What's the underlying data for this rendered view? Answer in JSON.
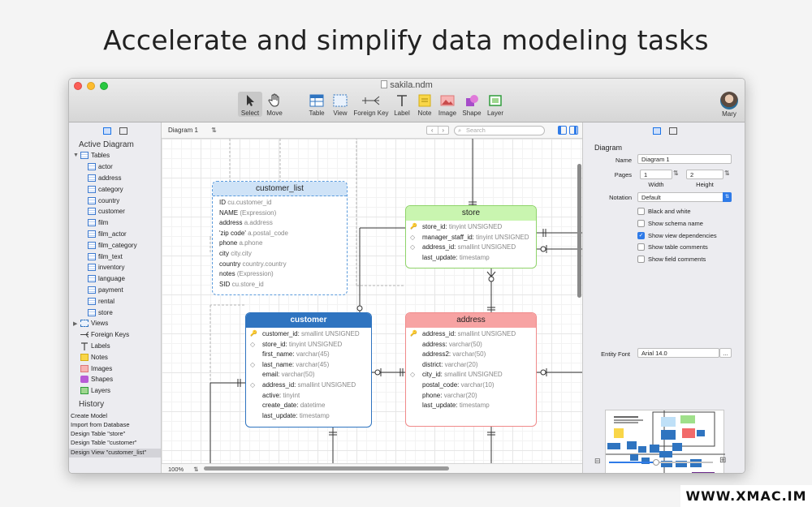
{
  "headline": "Accelerate and simplify data modeling tasks",
  "window": {
    "title": "sakila.ndm"
  },
  "toolbar": {
    "tools": [
      {
        "label": "Select",
        "icon": "cursor-icon"
      },
      {
        "label": "Move",
        "icon": "hand-icon"
      },
      {
        "label": "Table",
        "icon": "table-icon"
      },
      {
        "label": "View",
        "icon": "view-icon"
      },
      {
        "label": "Foreign Key",
        "icon": "foreign-key-icon"
      },
      {
        "label": "Label",
        "icon": "label-icon"
      },
      {
        "label": "Note",
        "icon": "note-icon"
      },
      {
        "label": "Image",
        "icon": "image-icon"
      },
      {
        "label": "Shape",
        "icon": "shape-icon"
      },
      {
        "label": "Layer",
        "icon": "layer-icon"
      }
    ],
    "user": "Mary"
  },
  "sidebar": {
    "section_title": "Active Diagram",
    "tables_label": "Tables",
    "tables": [
      "actor",
      "address",
      "category",
      "country",
      "customer",
      "film",
      "film_actor",
      "film_category",
      "film_text",
      "inventory",
      "language",
      "payment",
      "rental",
      "store"
    ],
    "other": [
      {
        "label": "Views"
      },
      {
        "label": "Foreign Keys"
      },
      {
        "label": "Labels"
      },
      {
        "label": "Notes"
      },
      {
        "label": "Images"
      },
      {
        "label": "Shapes"
      },
      {
        "label": "Layers"
      }
    ],
    "history_title": "History",
    "history": [
      "Create Model",
      "Import from Database",
      "Design Table \"store\"",
      "Design Table \"customer\"",
      "Design View \"customer_list\""
    ]
  },
  "canvas_bar": {
    "diagram_select": "Diagram 1",
    "search_placeholder": "Search",
    "zoom": "100%"
  },
  "entities": {
    "customer_list": {
      "title": "customer_list",
      "rows": [
        {
          "name": "ID",
          "type": "cu.customer_id"
        },
        {
          "name": "NAME",
          "type": "(Expression)"
        },
        {
          "name": "address",
          "type": "a.address"
        },
        {
          "name": "'zip code'",
          "type": "a.postal_code"
        },
        {
          "name": "phone",
          "type": "a.phone"
        },
        {
          "name": "city",
          "type": "city.city"
        },
        {
          "name": "country",
          "type": "country.country"
        },
        {
          "name": "notes",
          "type": "(Expression)"
        },
        {
          "name": "SID",
          "type": "cu.store_id"
        }
      ]
    },
    "store": {
      "title": "store",
      "color": "#c9f5b0",
      "rows": [
        {
          "name": "store_id:",
          "type": "tinyint UNSIGNED",
          "mark": "key"
        },
        {
          "name": "manager_staff_id:",
          "type": "tinyint UNSIGNED",
          "mark": "dia"
        },
        {
          "name": "address_id:",
          "type": "smallint UNSIGNED",
          "mark": "dia"
        },
        {
          "name": "last_update:",
          "type": "timestamp",
          "mark": ""
        }
      ]
    },
    "customer": {
      "title": "customer",
      "color": "#2f74c0",
      "rows": [
        {
          "name": "customer_id:",
          "type": "smallint UNSIGNED",
          "mark": "key"
        },
        {
          "name": "store_id:",
          "type": "tinyint UNSIGNED",
          "mark": "dia"
        },
        {
          "name": "first_name:",
          "type": "varchar(45)",
          "mark": ""
        },
        {
          "name": "last_name:",
          "type": "varchar(45)",
          "mark": "dia"
        },
        {
          "name": "email:",
          "type": "varchar(50)",
          "mark": ""
        },
        {
          "name": "address_id:",
          "type": "smallint UNSIGNED",
          "mark": "dia"
        },
        {
          "name": "active:",
          "type": "tinyint",
          "mark": ""
        },
        {
          "name": "create_date:",
          "type": "datetime",
          "mark": ""
        },
        {
          "name": "last_update:",
          "type": "timestamp",
          "mark": ""
        }
      ]
    },
    "address": {
      "title": "address",
      "color": "#f7a3a3",
      "rows": [
        {
          "name": "address_id:",
          "type": "smallint UNSIGNED",
          "mark": "key"
        },
        {
          "name": "address:",
          "type": "varchar(50)",
          "mark": ""
        },
        {
          "name": "address2:",
          "type": "varchar(50)",
          "mark": ""
        },
        {
          "name": "district:",
          "type": "varchar(20)",
          "mark": ""
        },
        {
          "name": "city_id:",
          "type": "smallint UNSIGNED",
          "mark": "dia"
        },
        {
          "name": "postal_code:",
          "type": "varchar(10)",
          "mark": ""
        },
        {
          "name": "phone:",
          "type": "varchar(20)",
          "mark": ""
        },
        {
          "name": "last_update:",
          "type": "timestamp",
          "mark": ""
        }
      ]
    }
  },
  "inspector": {
    "section": "Diagram",
    "name_label": "Name",
    "name_value": "Diagram 1",
    "pages_label": "Pages",
    "width_value": "1",
    "height_value": "2",
    "width_label": "Width",
    "height_label": "Height",
    "notation_label": "Notation",
    "notation_value": "Default",
    "checks": [
      {
        "label": "Black and white",
        "checked": false
      },
      {
        "label": "Show schema name",
        "checked": false
      },
      {
        "label": "Show view dependencies",
        "checked": true
      },
      {
        "label": "Show table comments",
        "checked": false
      },
      {
        "label": "Show field comments",
        "checked": false
      }
    ],
    "font_label": "Entity Font",
    "font_value": "Arial  14.0",
    "font_button": "...",
    "zoom_slider": 0.45
  },
  "watermark": "WWW.XMAC.IM"
}
